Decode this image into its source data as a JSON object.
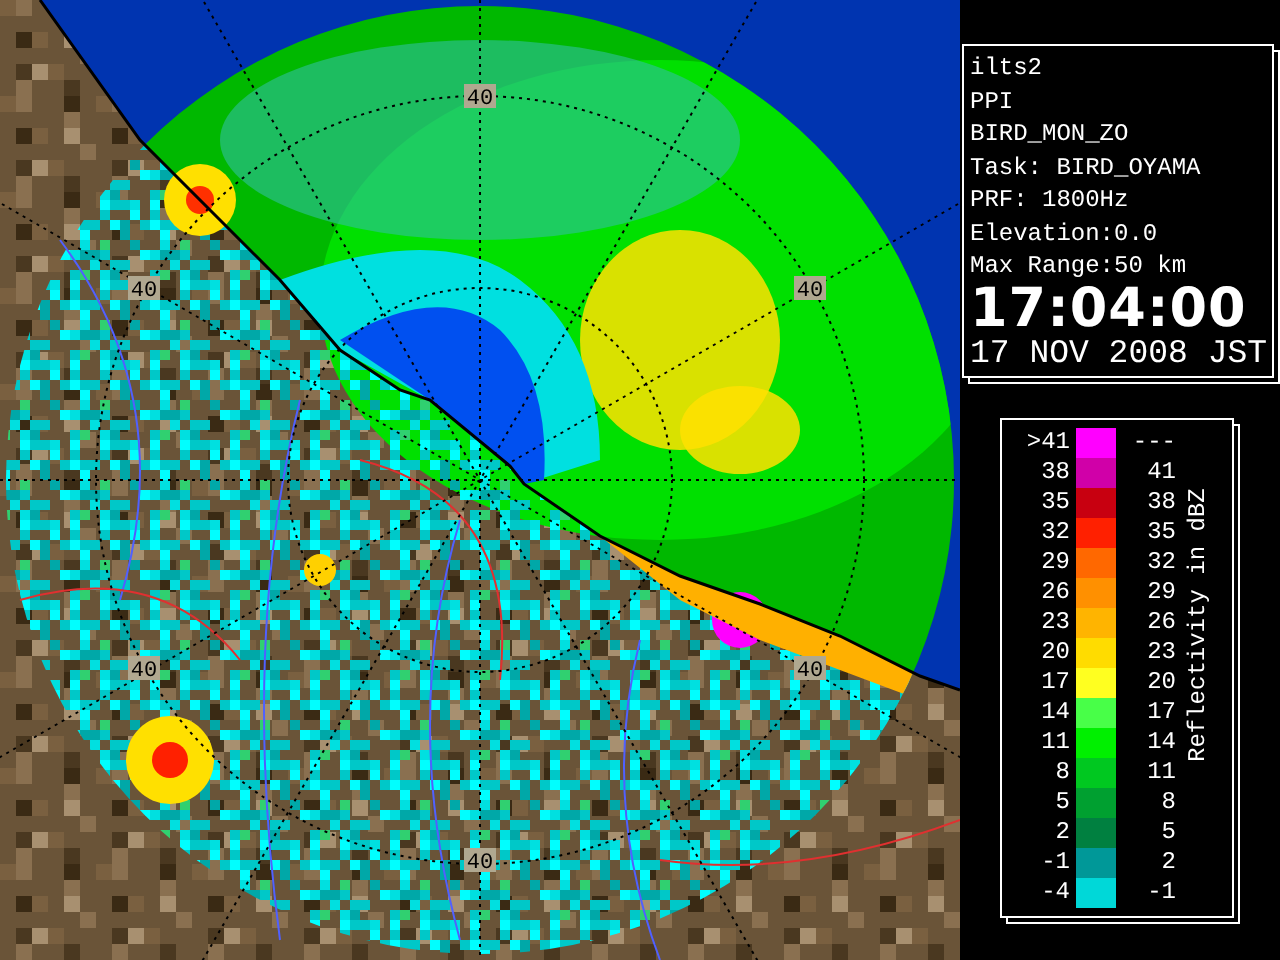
{
  "radar_map": {
    "range_labels": [
      "40",
      "40",
      "40",
      "40",
      "40",
      "40"
    ]
  },
  "info_panel": {
    "lines": [
      "ilts2",
      "PPI",
      "BIRD_MON_ZO",
      "Task: BIRD_OYAMA",
      "PRF: 1800Hz",
      "Elevation:0.0",
      "Max Range:50 km"
    ],
    "time": "17:04:00",
    "date": "17 NOV 2008 JST"
  },
  "legend": {
    "title": "Reflectivity in dBZ",
    "bins": [
      {
        "low": ">41",
        "high": "---",
        "color": "#ff00ff"
      },
      {
        "low": "38",
        "high": "41",
        "color": "#d000a8"
      },
      {
        "low": "35",
        "high": "38",
        "color": "#c80010"
      },
      {
        "low": "32",
        "high": "35",
        "color": "#ff2000"
      },
      {
        "low": "29",
        "high": "32",
        "color": "#ff6800"
      },
      {
        "low": "26",
        "high": "29",
        "color": "#ff9000"
      },
      {
        "low": "23",
        "high": "26",
        "color": "#ffb400"
      },
      {
        "low": "20",
        "high": "23",
        "color": "#ffdc00"
      },
      {
        "low": "17",
        "high": "20",
        "color": "#ffff20"
      },
      {
        "low": "14",
        "high": "17",
        "color": "#48ff48"
      },
      {
        "low": "11",
        "high": "14",
        "color": "#00f000"
      },
      {
        "low": "8",
        "high": "11",
        "color": "#00c820"
      },
      {
        "low": "5",
        "high": "8",
        "color": "#00a030"
      },
      {
        "low": "2",
        "high": "5",
        "color": "#008040"
      },
      {
        "low": "-1",
        "high": "2",
        "color": "#009898"
      },
      {
        "low": "-4",
        "high": "-1",
        "color": "#00d8d8"
      }
    ]
  }
}
